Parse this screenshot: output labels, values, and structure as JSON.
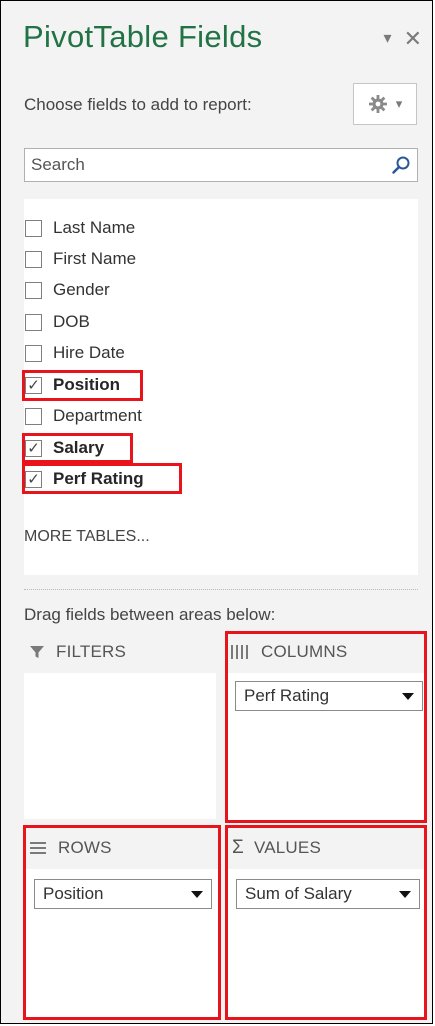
{
  "pane": {
    "title": "PivotTable Fields",
    "choose_label": "Choose fields to add to report:",
    "dropdown_icon": "chevron-down-icon",
    "close_icon": "close-icon",
    "gear_icon": "gear-icon",
    "search_placeholder": "Search",
    "search_icon": "search-icon"
  },
  "fields": [
    {
      "label": "Last Name",
      "checked": false
    },
    {
      "label": "First Name",
      "checked": false
    },
    {
      "label": "Gender",
      "checked": false
    },
    {
      "label": "DOB",
      "checked": false
    },
    {
      "label": "Hire Date",
      "checked": false
    },
    {
      "label": "Position",
      "checked": true
    },
    {
      "label": "Department",
      "checked": false
    },
    {
      "label": "Salary",
      "checked": true
    },
    {
      "label": "Perf Rating",
      "checked": true
    }
  ],
  "more_tables": "MORE TABLES...",
  "drag_label": "Drag fields between areas below:",
  "areas": {
    "filters": {
      "label": "FILTERS",
      "icon": "filter-icon"
    },
    "columns": {
      "label": "COLUMNS",
      "icon": "columns-icon",
      "items": [
        "Perf Rating"
      ]
    },
    "rows": {
      "label": "ROWS",
      "icon": "rows-icon",
      "items": [
        "Position"
      ]
    },
    "values": {
      "label": "VALUES",
      "icon": "sigma-icon",
      "symbol": "Σ",
      "items": [
        "Sum of Salary"
      ]
    }
  },
  "check_mark": "✓",
  "colors": {
    "title": "#217346",
    "highlight": "#e8141c",
    "pane_bg": "#f3f3f3"
  }
}
